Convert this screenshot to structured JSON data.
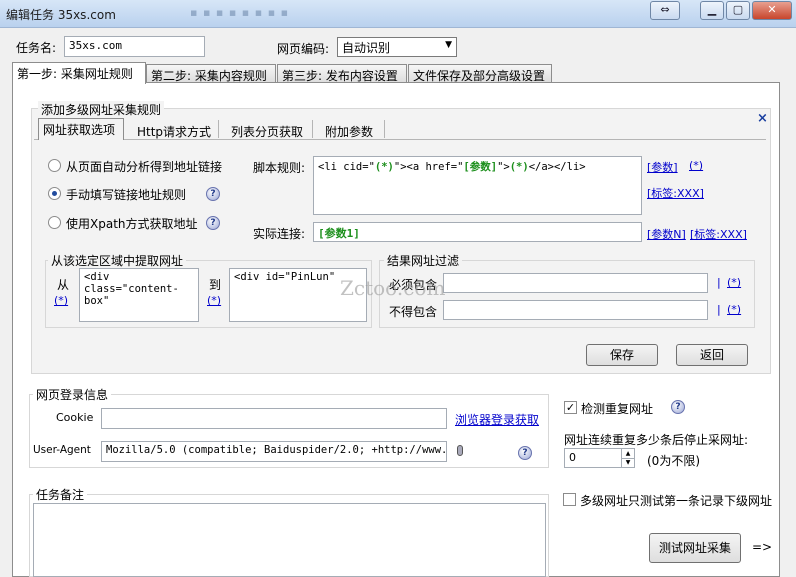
{
  "window": {
    "title": "编辑任务 35xs.com"
  },
  "task": {
    "name_label": "任务名:",
    "name_value": "35xs.com",
    "encoding_label": "网页编码:",
    "encoding_value": "自动识别"
  },
  "tabs": [
    "第一步: 采集网址规则",
    "第二步: 采集内容规则",
    "第三步: 发布内容设置",
    "文件保存及部分高级设置"
  ],
  "rule_group": {
    "title": "添加多级网址采集规则",
    "subtabs": [
      "网址获取选项",
      "Http请求方式",
      "列表分页获取",
      "附加参数"
    ],
    "close": "×",
    "radios": [
      "从页面自动分析得到地址链接",
      "手动填写链接地址规则",
      "使用Xpath方式获取地址"
    ],
    "script_label": "脚本规则:",
    "script_parts": [
      "<li  cid=\"",
      "(*)",
      "\"><a  href=\"",
      "[参数]",
      "\">",
      "(*)",
      "</a></li>"
    ],
    "link_param": "[参数]",
    "link_star": "(*)",
    "link_tag": "[标签:XXX]",
    "actual_label": "实际连接:",
    "actual_value": "[参数1]",
    "link_paramN": "[参数N]",
    "link_tag2": "[标签:XXX]"
  },
  "region": {
    "title": "从该选定区域中提取网址",
    "from_label": "从",
    "from_star": "(*)",
    "from_text": "<div class=\"content-box\"",
    "to_label": "到",
    "to_star": "(*)",
    "to_text": "<div id=\"PinLun\""
  },
  "filter": {
    "title": "结果网址过滤",
    "must_label": "必须包含",
    "not_label": "不得包含",
    "sep": "|",
    "star": "(*)"
  },
  "watermark": "Zctoo.com",
  "actions": {
    "save": "保存",
    "back": "返回"
  },
  "login": {
    "title": "网页登录信息",
    "cookie_label": "Cookie",
    "cookie_value": "",
    "browser_link": "浏览器登录获取",
    "ua_label": "User-Agent",
    "ua_value": "Mozilla/5.0 (compatible; Baiduspider/2.0; +http://www.bai"
  },
  "options": {
    "check_dup": "检测重复网址",
    "check_dup_checked": true,
    "stop_label": "网址连续重复多少条后停止采网址:",
    "stop_value": "0",
    "stop_hint": "(0为不限)",
    "multi_label": "多级网址只测试第一条记录下级网址",
    "multi_checked": false,
    "test_button": "测试网址采集",
    "arrow": "=>"
  },
  "notes": {
    "title": "任务备注",
    "value": ""
  },
  "colors": {
    "accent_link": "#0000cc",
    "param_green": "#1c8f1c",
    "title_bar": "#c9dcf2"
  }
}
